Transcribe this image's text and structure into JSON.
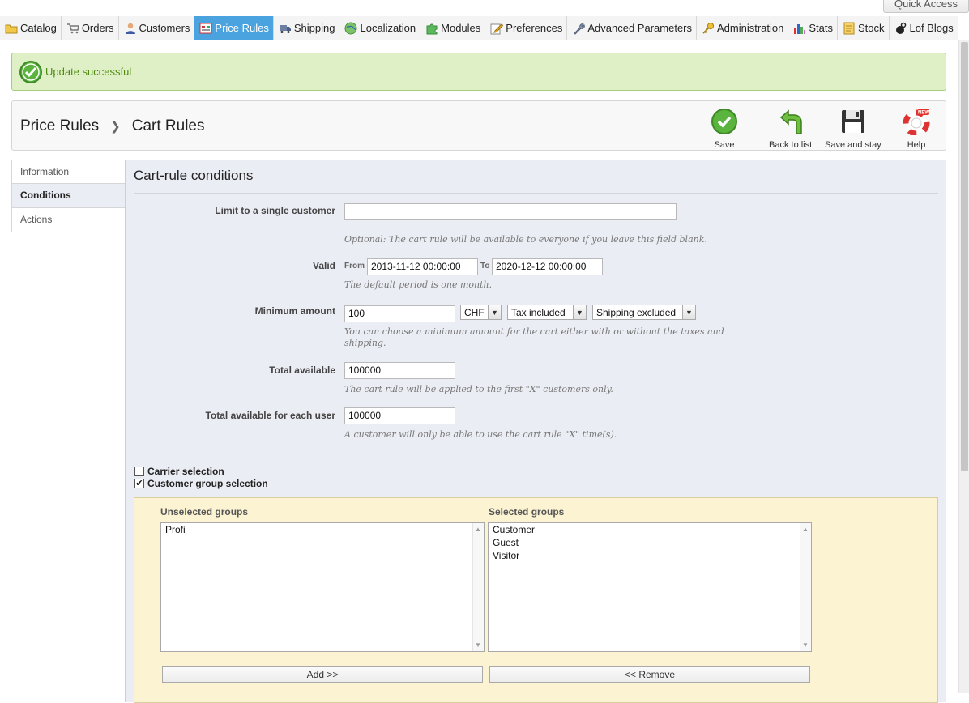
{
  "quick_access": "Quick Access",
  "menu": [
    {
      "label": "Catalog",
      "icon": "folder-icon"
    },
    {
      "label": "Orders",
      "icon": "cart-icon"
    },
    {
      "label": "Customers",
      "icon": "user-icon"
    },
    {
      "label": "Price Rules",
      "icon": "price-tag-icon",
      "active": true
    },
    {
      "label": "Shipping",
      "icon": "truck-icon"
    },
    {
      "label": "Localization",
      "icon": "globe-icon"
    },
    {
      "label": "Modules",
      "icon": "puzzle-icon"
    },
    {
      "label": "Preferences",
      "icon": "pencil-paper-icon"
    },
    {
      "label": "Advanced Parameters",
      "icon": "wrench-icon"
    },
    {
      "label": "Administration",
      "icon": "key-icon"
    },
    {
      "label": "Stats",
      "icon": "bar-chart-icon"
    },
    {
      "label": "Stock",
      "icon": "note-icon"
    },
    {
      "label": "Lof Blogs",
      "icon": "blog-icon"
    }
  ],
  "success_message": "Update successful",
  "breadcrumb": {
    "parent": "Price Rules",
    "current": "Cart Rules"
  },
  "toolbar": {
    "save": "Save",
    "back": "Back to list",
    "save_stay": "Save and stay",
    "help": "Help",
    "help_badge": "NEW"
  },
  "tabs": [
    {
      "label": "Information"
    },
    {
      "label": "Conditions",
      "active": true
    },
    {
      "label": "Actions"
    }
  ],
  "panel": {
    "title": "Cart-rule conditions",
    "limit_label": "Limit to a single customer",
    "limit_value": "",
    "limit_hint": "Optional: The cart rule will be available to everyone if you leave this field blank.",
    "valid_label": "Valid",
    "from_label": "From",
    "from_value": "2013-11-12 00:00:00",
    "to_label": "To",
    "to_value": "2020-12-12 00:00:00",
    "valid_hint": "The default period is one month.",
    "min_label": "Minimum amount",
    "min_value": "100",
    "currency": "CHF",
    "tax": "Tax included",
    "shipping": "Shipping excluded",
    "min_hint_1": "You can choose a minimum amount for the cart either with or without the taxes and",
    "min_hint_2": "shipping.",
    "total_label": "Total available",
    "total_value": "100000",
    "total_hint": "The cart rule will be applied to the first \"X\" customers only.",
    "per_user_label": "Total available for each user",
    "per_user_value": "100000",
    "per_user_hint": "A customer will only be able to use the cart rule \"X\" time(s).",
    "carrier_label": "Carrier selection",
    "carrier_checked": false,
    "group_label": "Customer group selection",
    "group_checked": true
  },
  "groups": {
    "unselected_title": "Unselected groups",
    "unselected": [
      "Profi"
    ],
    "selected_title": "Selected groups",
    "selected": [
      "Customer",
      "Guest",
      "Visitor"
    ],
    "add_label": "Add >>",
    "remove_label": "<< Remove"
  },
  "colors": {
    "accent": "#4aa3df",
    "success_bg": "#dff0c7",
    "panel_bg": "#ebedf4",
    "groups_bg": "#fcf3d3"
  }
}
